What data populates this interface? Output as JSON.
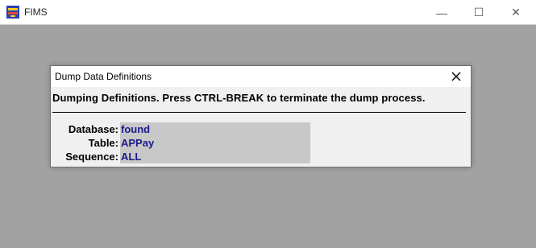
{
  "window": {
    "title": "FIMS",
    "minimize_glyph": "—",
    "maximize_glyph": "☐",
    "close_glyph": "✕"
  },
  "dialog": {
    "title": "Dump Data Definitions",
    "message": "Dumping Definitions.  Press CTRL-BREAK to terminate the dump process.",
    "fields": [
      {
        "label": "Database:",
        "value": "found"
      },
      {
        "label": "Table:",
        "value": "APPay"
      },
      {
        "label": "Sequence:",
        "value": "ALL"
      }
    ]
  },
  "colors": {
    "workspace": "#a2a2a2",
    "field_value": "#1a1a8c",
    "field_panel": "#c8c8c8"
  }
}
